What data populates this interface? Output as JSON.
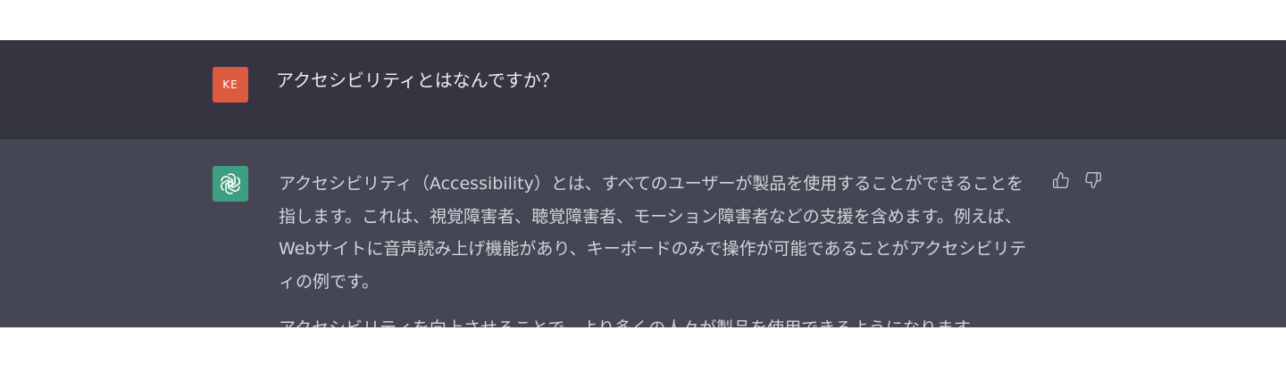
{
  "user_message": {
    "avatar_initials": "KE",
    "text": "アクセシビリティとはなんですか？"
  },
  "assistant_message": {
    "avatar_icon": "openai-logo-icon",
    "paragraphs": [
      "アクセシビリティ（Accessibility）とは、すべてのユーザーが製品を使用することができることを指します。これは、視覚障害者、聴覚障害者、モーション障害者などの支援を含めます。例えば、Webサイトに音声読み上げ機能があり、キーボードのみで操作が可能であることがアクセシビリティの例です。",
      "アクセシビリティを向上させることで、より多くの人々が製品を使用できるようになります。"
    ]
  },
  "feedback": {
    "thumbs_up_icon": "thumbs-up-icon",
    "thumbs_down_icon": "thumbs-down-icon"
  },
  "colors": {
    "user_row_bg": "#343541",
    "assistant_row_bg": "#444654",
    "user_avatar_bg": "#dc5a40",
    "assistant_avatar_bg": "#3f9d82"
  }
}
